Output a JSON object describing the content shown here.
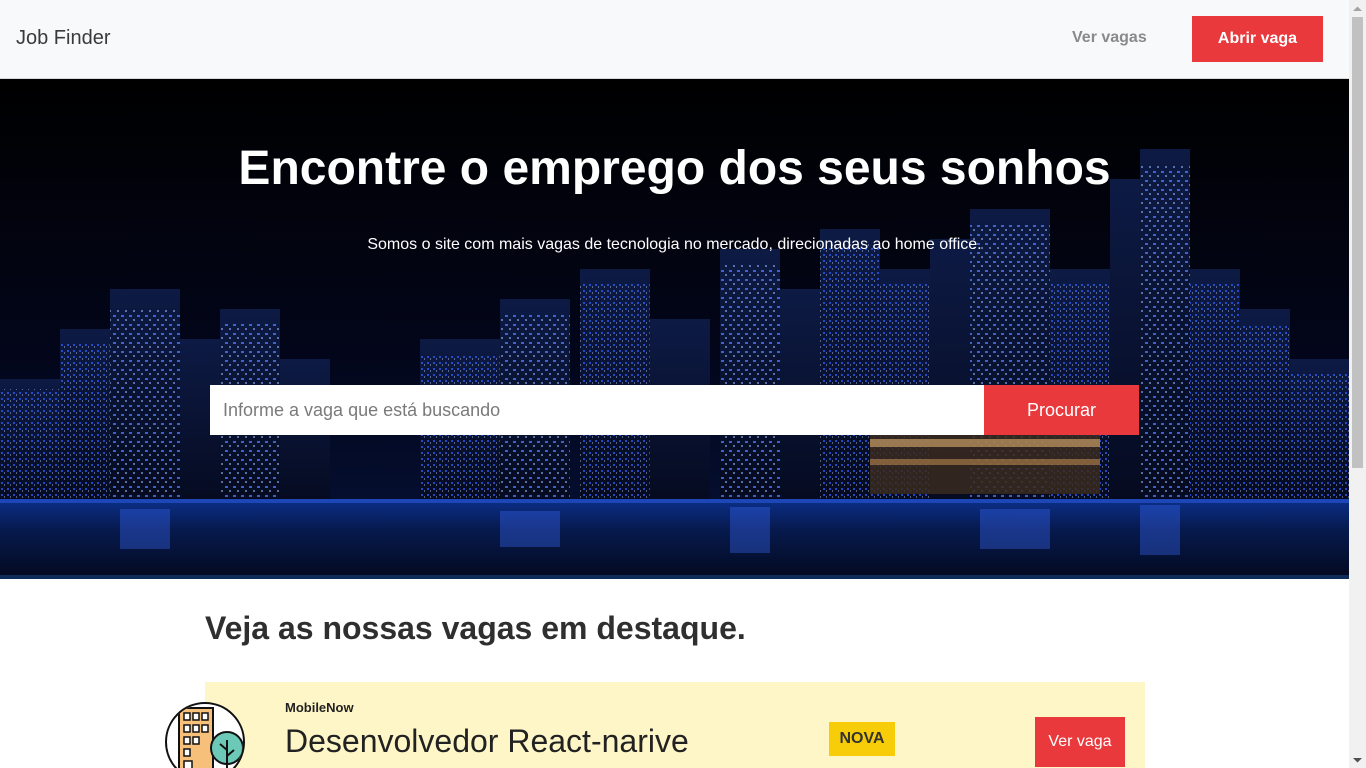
{
  "navbar": {
    "brand": "Job Finder",
    "link": "Ver vagas",
    "cta": "Abrir vaga"
  },
  "hero": {
    "title": "Encontre o emprego dos seus sonhos",
    "subtitle": "Somos o site com mais vagas de tecnologia no mercado, direcionadas ao home office.",
    "search_placeholder": "Informe a vaga que está buscando",
    "search_button": "Procurar"
  },
  "featured": {
    "heading": "Veja as nossas vagas em destaque.",
    "jobs": [
      {
        "company": "MobileNow",
        "title": "Desenvolvedor React-narive",
        "badge": "NOVA",
        "action": "Ver vaga",
        "logo_icon": "building-tree-icon"
      }
    ]
  },
  "colors": {
    "accent": "#e9393d",
    "badge": "#f7cd0a",
    "card": "#fff6c8"
  }
}
